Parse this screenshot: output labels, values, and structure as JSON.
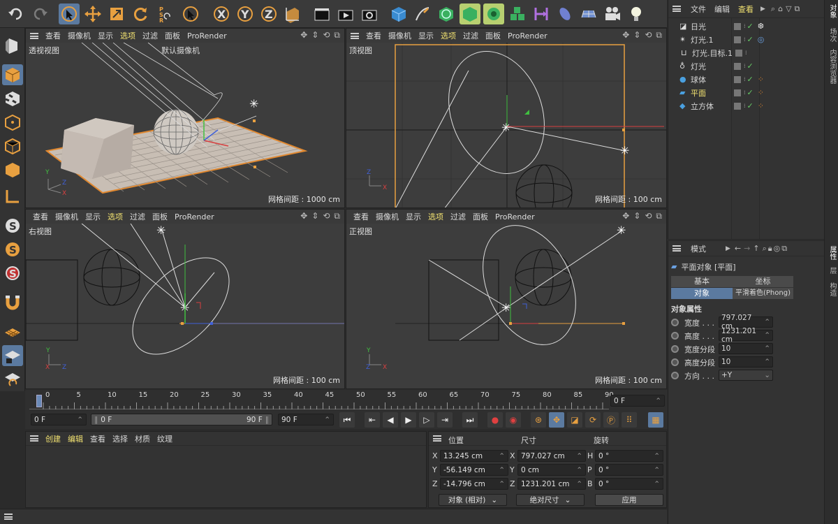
{
  "colors": {
    "accent": "#5b7aa0",
    "highlight": "#f0e070",
    "selection_orange": "#e09030",
    "axis_x": "#d84040",
    "axis_y": "#40c040",
    "axis_z": "#4060d8"
  },
  "viewports": {
    "menu": [
      "查看",
      "摄像机",
      "显示",
      "选项",
      "过滤",
      "面板",
      "ProRender"
    ],
    "perspective": {
      "name": "透视视图",
      "camera": "默认摄像机",
      "grid": "网格间距 : 1000 cm"
    },
    "top": {
      "name": "顶视图",
      "grid": "网格间距 : 100 cm"
    },
    "right": {
      "name": "右视图",
      "grid": "网格间距 : 100 cm"
    },
    "front": {
      "name": "正视图",
      "grid": "网格间距 : 100 cm"
    }
  },
  "timeline": {
    "ticks": [
      "0",
      "5",
      "10",
      "15",
      "20",
      "25",
      "30",
      "35",
      "40",
      "45",
      "50",
      "55",
      "60",
      "65",
      "70",
      "75",
      "80",
      "85",
      "90"
    ],
    "current_frame": "0 F",
    "start": "0 F",
    "range_start": "0 F",
    "range_end": "90 F",
    "end": "90 F"
  },
  "material_panel": {
    "menu": [
      "创建",
      "编辑",
      "查看",
      "选择",
      "材质",
      "纹理"
    ]
  },
  "coords": {
    "headers": {
      "position": "位置",
      "size": "尺寸",
      "rotation": "旋转"
    },
    "rows": [
      {
        "axis": "X",
        "pos": "13.245 cm",
        "saxis": "X",
        "size": "797.027 cm",
        "raxis": "H",
        "rot": "0 °"
      },
      {
        "axis": "Y",
        "pos": "-56.149 cm",
        "saxis": "Y",
        "size": "0 cm",
        "raxis": "P",
        "rot": "0 °"
      },
      {
        "axis": "Z",
        "pos": "-14.796 cm",
        "saxis": "Z",
        "size": "1231.201 cm",
        "raxis": "B",
        "rot": "0 °"
      }
    ],
    "mode": "对象 (相对)",
    "size_mode": "绝对尺寸",
    "apply": "应用"
  },
  "objects": {
    "menu": [
      "文件",
      "编辑",
      "查看"
    ],
    "items": [
      {
        "name": "日光",
        "icon": "sun-light-icon"
      },
      {
        "name": "灯光.1",
        "icon": "light-icon"
      },
      {
        "name": "灯光.目标.1",
        "icon": "target-icon"
      },
      {
        "name": "灯光",
        "icon": "bulb-icon"
      },
      {
        "name": "球体",
        "icon": "sphere-icon"
      },
      {
        "name": "平面",
        "icon": "plane-icon"
      },
      {
        "name": "立方体",
        "icon": "cube-icon"
      }
    ]
  },
  "attributes": {
    "mode_label": "模式",
    "object_title": "平面对象 [平面]",
    "tabs": [
      "基本",
      "坐标",
      "对象",
      "平滑着色(Phong)"
    ],
    "section": "对象属性",
    "fields": [
      {
        "label": "宽度 . . .",
        "value": "797.027 cm"
      },
      {
        "label": "高度 . . .",
        "value": "1231.201 cm"
      },
      {
        "label": "宽度分段",
        "value": "10"
      },
      {
        "label": "高度分段",
        "value": "10"
      },
      {
        "label": "方向 . . .",
        "value": "+Y"
      }
    ]
  },
  "right_tabs": {
    "top": [
      "对象",
      "场次",
      "内容浏览器"
    ],
    "bottom": [
      "属性",
      "层",
      "构造"
    ]
  }
}
